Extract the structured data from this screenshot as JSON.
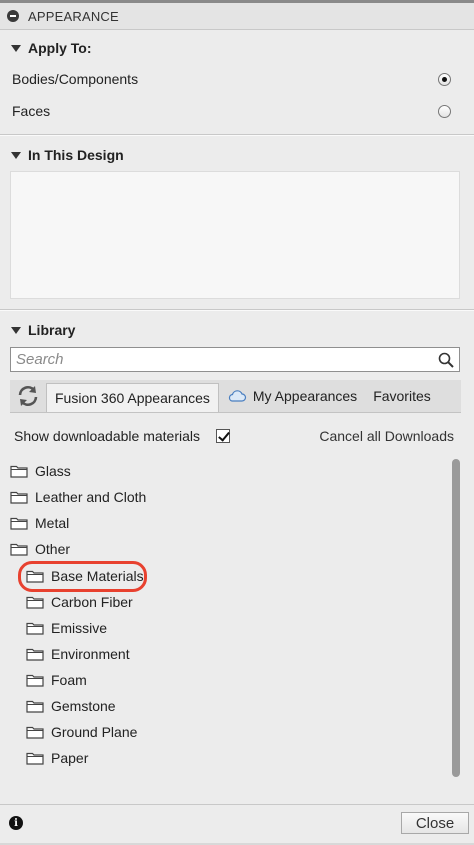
{
  "panel": {
    "title": "APPEARANCE"
  },
  "apply_to": {
    "heading": "Apply To:",
    "options": [
      {
        "label": "Bodies/Components",
        "selected": true
      },
      {
        "label": "Faces",
        "selected": false
      }
    ]
  },
  "in_this_design": {
    "heading": "In This Design"
  },
  "library": {
    "heading": "Library",
    "search": {
      "placeholder": "Search",
      "value": ""
    },
    "tabs": [
      {
        "label": "Fusion 360 Appearances",
        "active": true
      },
      {
        "label": "My Appearances",
        "icon": "cloud-icon",
        "active": false
      },
      {
        "label": "Favorites",
        "active": false
      }
    ],
    "show_downloadable": {
      "label": "Show downloadable materials",
      "checked": true
    },
    "cancel_downloads": "Cancel all Downloads",
    "folders": [
      {
        "label": "Glass",
        "level": 0
      },
      {
        "label": "Leather and Cloth",
        "level": 0
      },
      {
        "label": "Metal",
        "level": 0
      },
      {
        "label": "Other",
        "level": 0
      },
      {
        "label": "Base Materials",
        "level": 1,
        "highlighted": true
      },
      {
        "label": "Carbon Fiber",
        "level": 1
      },
      {
        "label": "Emissive",
        "level": 1
      },
      {
        "label": "Environment",
        "level": 1
      },
      {
        "label": "Foam",
        "level": 1
      },
      {
        "label": "Gemstone",
        "level": 1
      },
      {
        "label": "Ground Plane",
        "level": 1
      },
      {
        "label": "Paper",
        "level": 1
      }
    ]
  },
  "footer": {
    "close_label": "Close"
  },
  "colors": {
    "highlight": "#e8412f",
    "panel_bg": "#ececec",
    "design_area": "#f7f7f7"
  }
}
